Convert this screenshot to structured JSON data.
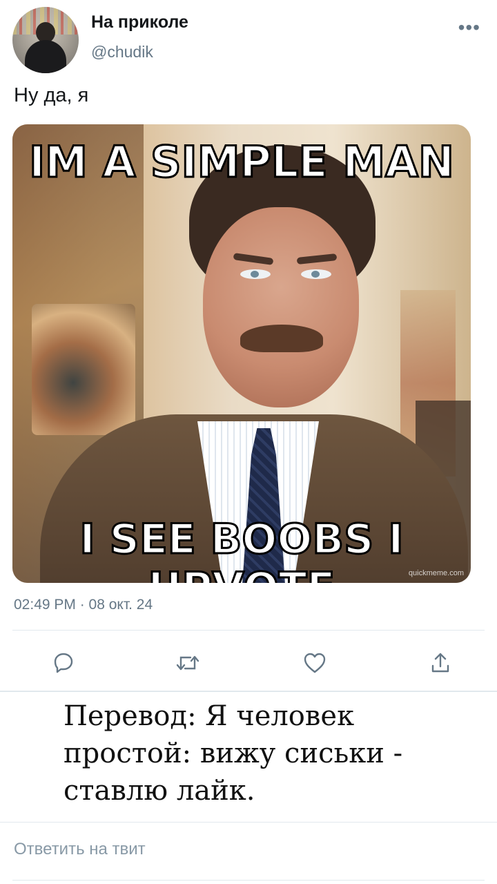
{
  "header": {
    "name": "На приколе",
    "handle": "@chudik",
    "more_label": "•••"
  },
  "tweet": {
    "text": "Ну да, я",
    "timestamp": "02:49 PM · 08 окт. 24"
  },
  "meme": {
    "top_text": "IM A SIMPLE MAN",
    "bottom_text": "I SEE BOOBS I UPVOTE",
    "watermark": "quickmeme.com"
  },
  "actions": {
    "items": [
      {
        "name": "reply",
        "icon": "speech-bubble-icon"
      },
      {
        "name": "retweet",
        "icon": "retweet-icon"
      },
      {
        "name": "like",
        "icon": "heart-icon"
      },
      {
        "name": "share",
        "icon": "share-icon"
      }
    ],
    "icon_color": "#657786"
  },
  "translation": {
    "text": "Перевод: Я человек простой: вижу сиськи - ставлю лайк."
  },
  "reply_box": {
    "placeholder": "Ответить на твит"
  }
}
